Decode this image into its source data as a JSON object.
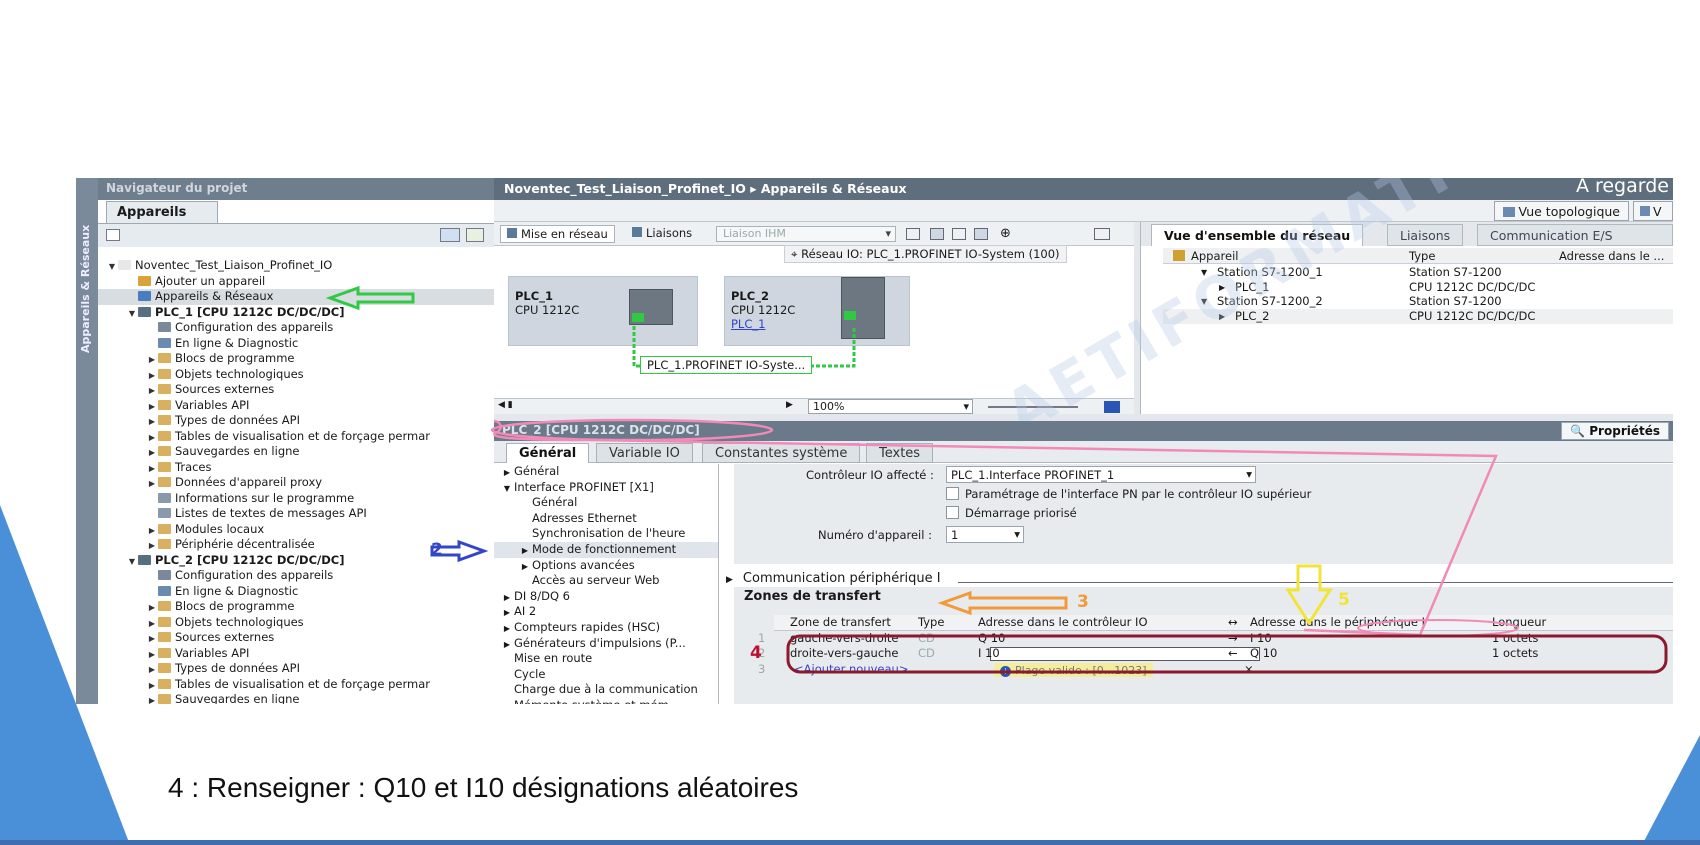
{
  "caption": "4  : Renseigner : Q10 et I10 désignations aléatoires",
  "watermark": "AETIFORMATION OBJECT",
  "project_nav": {
    "header": "Navigateur du projet",
    "tab": "Appareils",
    "vertical_tab": "Appareils & Réseaux",
    "tree": [
      {
        "label": "Noventec_Test_Liaison_Profinet_IO",
        "indent": 0,
        "arrow": "▼",
        "icon": "#e8e8e8",
        "bold": false
      },
      {
        "label": "Ajouter un appareil",
        "indent": 1,
        "arrow": "",
        "icon": "#d9a23a",
        "bold": false
      },
      {
        "label": "Appareils & Réseaux",
        "indent": 1,
        "arrow": "",
        "icon": "#4a7cc0",
        "bold": false,
        "hl": true
      },
      {
        "label": "PLC_1 [CPU 1212C DC/DC/DC]",
        "indent": 1,
        "arrow": "▼",
        "icon": "#5a6e82",
        "bold": true
      },
      {
        "label": "Configuration des appareils",
        "indent": 2,
        "arrow": "",
        "icon": "#7a8a9a",
        "bold": false
      },
      {
        "label": "En ligne & Diagnostic",
        "indent": 2,
        "arrow": "",
        "icon": "#6a8ab0",
        "bold": false
      },
      {
        "label": "Blocs de programme",
        "indent": 2,
        "arrow": "▶",
        "icon": "#d8b060",
        "bold": false
      },
      {
        "label": "Objets technologiques",
        "indent": 2,
        "arrow": "▶",
        "icon": "#d8b060",
        "bold": false
      },
      {
        "label": "Sources externes",
        "indent": 2,
        "arrow": "▶",
        "icon": "#d8b060",
        "bold": false
      },
      {
        "label": "Variables API",
        "indent": 2,
        "arrow": "▶",
        "icon": "#d8b060",
        "bold": false
      },
      {
        "label": "Types de données API",
        "indent": 2,
        "arrow": "▶",
        "icon": "#d8b060",
        "bold": false
      },
      {
        "label": "Tables de visualisation et de forçage permar",
        "indent": 2,
        "arrow": "▶",
        "icon": "#d8b060",
        "bold": false
      },
      {
        "label": "Sauvegardes en ligne",
        "indent": 2,
        "arrow": "▶",
        "icon": "#d8b060",
        "bold": false
      },
      {
        "label": "Traces",
        "indent": 2,
        "arrow": "▶",
        "icon": "#d8b060",
        "bold": false
      },
      {
        "label": "Données d'appareil proxy",
        "indent": 2,
        "arrow": "▶",
        "icon": "#d8b060",
        "bold": false
      },
      {
        "label": "Informations sur le programme",
        "indent": 2,
        "arrow": "",
        "icon": "#8a9aaa",
        "bold": false
      },
      {
        "label": "Listes de textes de messages API",
        "indent": 2,
        "arrow": "",
        "icon": "#8a9aaa",
        "bold": false
      },
      {
        "label": "Modules locaux",
        "indent": 2,
        "arrow": "▶",
        "icon": "#d8b060",
        "bold": false
      },
      {
        "label": "Périphérie décentralisée",
        "indent": 2,
        "arrow": "▶",
        "icon": "#d8b060",
        "bold": false
      },
      {
        "label": "PLC_2 [CPU 1212C DC/DC/DC]",
        "indent": 1,
        "arrow": "▼",
        "icon": "#5a6e82",
        "bold": true
      },
      {
        "label": "Configuration des appareils",
        "indent": 2,
        "arrow": "",
        "icon": "#7a8a9a",
        "bold": false
      },
      {
        "label": "En ligne & Diagnostic",
        "indent": 2,
        "arrow": "",
        "icon": "#6a8ab0",
        "bold": false
      },
      {
        "label": "Blocs de programme",
        "indent": 2,
        "arrow": "▶",
        "icon": "#d8b060",
        "bold": false
      },
      {
        "label": "Objets technologiques",
        "indent": 2,
        "arrow": "▶",
        "icon": "#d8b060",
        "bold": false
      },
      {
        "label": "Sources externes",
        "indent": 2,
        "arrow": "▶",
        "icon": "#d8b060",
        "bold": false
      },
      {
        "label": "Variables API",
        "indent": 2,
        "arrow": "▶",
        "icon": "#d8b060",
        "bold": false
      },
      {
        "label": "Types de données API",
        "indent": 2,
        "arrow": "▶",
        "icon": "#d8b060",
        "bold": false
      },
      {
        "label": "Tables de visualisation et de forçage permar",
        "indent": 2,
        "arrow": "▶",
        "icon": "#d8b060",
        "bold": false
      },
      {
        "label": "Sauvegardes en ligne",
        "indent": 2,
        "arrow": "▶",
        "icon": "#d8b060",
        "bold": false
      }
    ]
  },
  "main": {
    "breadcrumb": "Noventec_Test_Liaison_Profinet_IO  ▸  Appareils & Réseaux",
    "region_label": "À regarde",
    "topology_button": "Vue topologique",
    "v_button": "V",
    "net_toolbar": {
      "network_button": "Mise en réseau",
      "links_button": "Liaisons",
      "hmi_dropdown": "Liaison IHM"
    },
    "io_network_label": "Réseau IO: PLC_1.PROFINET IO-System (100)",
    "plc1": {
      "name": "PLC_1",
      "cpu": "CPU 1212C"
    },
    "plc2": {
      "name": "PLC_2",
      "cpu": "CPU 1212C",
      "link": "PLC_1"
    },
    "profinet_label": "PLC_1.PROFINET IO-Syste...",
    "zoom": "100%"
  },
  "overview": {
    "tabs": [
      "Vue d'ensemble du réseau",
      "Liaisons",
      "Communication E/S"
    ],
    "columns": [
      "Appareil",
      "Type",
      "Adresse dans le ..."
    ],
    "rows": [
      {
        "device": "Station S7-1200_1",
        "type": "Station S7-1200",
        "indent": 1,
        "arrow": "▼"
      },
      {
        "device": "PLC_1",
        "type": "CPU 1212C DC/DC/DC",
        "indent": 2,
        "arrow": "▶"
      },
      {
        "device": "Station S7-1200_2",
        "type": "Station S7-1200",
        "indent": 1,
        "arrow": "▼"
      },
      {
        "device": "PLC_2",
        "type": "CPU 1212C DC/DC/DC",
        "indent": 2,
        "arrow": "▶"
      }
    ]
  },
  "properties": {
    "title": "PLC_2 [CPU 1212C DC/DC/DC]",
    "props_button": "Propriétés",
    "tabs": [
      "Général",
      "Variable IO",
      "Constantes système",
      "Textes"
    ],
    "nav": [
      {
        "label": "Général",
        "indent": 0,
        "arrow": "▶"
      },
      {
        "label": "Interface PROFINET [X1]",
        "indent": 0,
        "arrow": "▼"
      },
      {
        "label": "Général",
        "indent": 1,
        "arrow": ""
      },
      {
        "label": "Adresses Ethernet",
        "indent": 1,
        "arrow": ""
      },
      {
        "label": "Synchronisation de l'heure",
        "indent": 1,
        "arrow": ""
      },
      {
        "label": "Mode de fonctionnement",
        "indent": 1,
        "arrow": "▶",
        "sel": true
      },
      {
        "label": "Options avancées",
        "indent": 1,
        "arrow": "▶"
      },
      {
        "label": "Accès au serveur Web",
        "indent": 1,
        "arrow": ""
      },
      {
        "label": "DI 8/DQ 6",
        "indent": 0,
        "arrow": "▶"
      },
      {
        "label": "AI 2",
        "indent": 0,
        "arrow": "▶"
      },
      {
        "label": "Compteurs rapides (HSC)",
        "indent": 0,
        "arrow": "▶"
      },
      {
        "label": "Générateurs d'impulsions (P...",
        "indent": 0,
        "arrow": "▶"
      },
      {
        "label": "Mise en route",
        "indent": 0,
        "arrow": ""
      },
      {
        "label": "Cycle",
        "indent": 0,
        "arrow": ""
      },
      {
        "label": "Charge due à la communication",
        "indent": 0,
        "arrow": ""
      },
      {
        "label": "Mémento système et mém...",
        "indent": 0,
        "arrow": ""
      }
    ],
    "controller_label": "Contrôleur IO affecté :",
    "controller_value": "PLC_1.Interface PROFINET_1",
    "check1": "Paramétrage de l'interface PN par le contrôleur IO supérieur",
    "check2": "Démarrage priorisé",
    "device_number_label": "Numéro d'appareil :",
    "device_number_value": "1",
    "comm_section": "Communication périphérique I",
    "transfer_section": "Zones de transfert",
    "table_columns": {
      "zone": "Zone de transfert",
      "type": "Type",
      "ctrl": "Adresse dans le contrôleur IO",
      "dir": "↔",
      "peri": "Adresse dans le périphérique I",
      "len": "Longueur"
    },
    "rows": [
      {
        "num": "1",
        "zone": "gauche-vers-droite",
        "type": "CD",
        "ctrl": "Q 10",
        "dir": "→",
        "peri": "I 10",
        "len": "1 octets"
      },
      {
        "num": "2",
        "zone": "droite-vers-gauche",
        "type": "CD",
        "ctrl": "I 10",
        "dir": "←",
        "peri": "Q 10",
        "len": "1 octets"
      }
    ],
    "add_row": {
      "num": "3",
      "zone": "<Ajouter nouveau>"
    },
    "tip": "Plage valide : [0...1023]"
  },
  "annotations": {
    "n2": "2",
    "n3": "3",
    "n4": "4",
    "n5": "5"
  },
  "colors": {
    "green": "#2fc944",
    "blue": "#3346c8",
    "orange": "#f29a3a",
    "yellow": "#f2e436",
    "pink": "#f28ab8",
    "dark_red": "#8a1a2e",
    "accent_blue": "#4a90d9"
  }
}
